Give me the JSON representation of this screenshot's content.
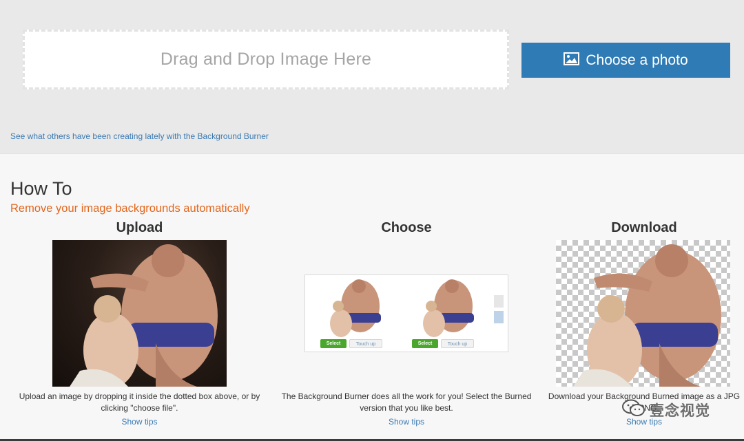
{
  "upload_area": {
    "dropzone_text": "Drag and Drop Image Here",
    "choose_button_label": "Choose a photo",
    "see_others_link": "See what others have been creating lately with the Background Burner"
  },
  "howto": {
    "title": "How To",
    "subtitle": "Remove your image backgrounds automatically",
    "steps": [
      {
        "title": "Upload",
        "description": "Upload an image by dropping it inside the dotted box above, or by clicking \"choose file\".",
        "tips_link": "Show tips"
      },
      {
        "title": "Choose",
        "description": "The Background Burner does all the work for you! Select the Burned version that you like best.",
        "tips_link": "Show tips",
        "preview_buttons": {
          "select": "Select",
          "touch_up": "Touch up"
        }
      },
      {
        "title": "Download",
        "description": "Download your Background Burned image as a JPG or PNG.",
        "tips_link": "Show tips"
      }
    ]
  },
  "watermark": {
    "text": "壹念视觉"
  },
  "colors": {
    "accent_button": "#2f7bb5",
    "link": "#3a7ab3",
    "subtitle_orange": "#e3661c",
    "select_green": "#4aa62c"
  },
  "icons": {
    "choose_button": "image-icon",
    "watermark": "wechat-icon"
  }
}
